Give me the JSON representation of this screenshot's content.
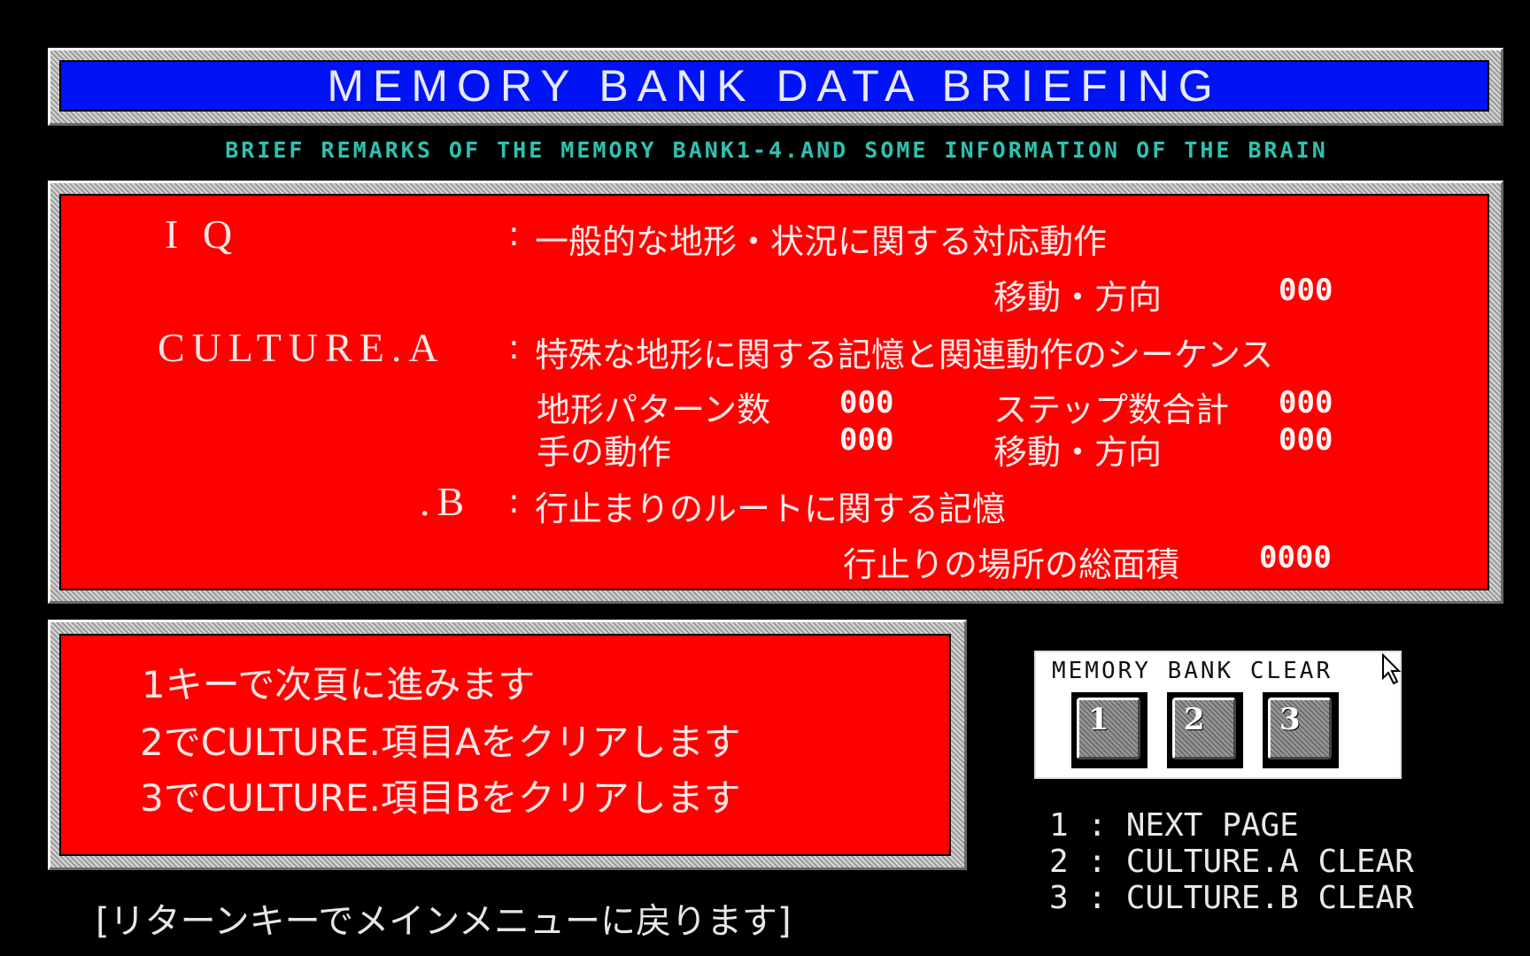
{
  "header": {
    "title": "MEMORY BANK DATA BRIEFING",
    "subtitle": "BRIEF REMARKS OF THE MEMORY BANK1-4.AND SOME INFORMATION OF THE BRAIN"
  },
  "colors": {
    "title_bar": "#0013f2",
    "panel": "#ff0000",
    "subtitle": "#2fc1b0",
    "background": "#000000"
  },
  "briefing": {
    "iq": {
      "label": "I Q",
      "colon": ":",
      "description": "一般的な地形・状況に関する対応動作",
      "stats": [
        {
          "label": "移動・方向",
          "value": "000"
        }
      ]
    },
    "culture_a": {
      "label": "CULTURE.A",
      "colon": ":",
      "description": "特殊な地形に関する記憶と関連動作のシーケンス",
      "stats": [
        {
          "label": "地形パターン数",
          "value": "000"
        },
        {
          "label": "ステップ数合計",
          "value": "000"
        },
        {
          "label": "手の動作",
          "value": "000"
        },
        {
          "label": "移動・方向",
          "value": "000"
        }
      ]
    },
    "culture_b": {
      "label": ".B",
      "colon": ":",
      "description": "行止まりのルートに関する記憶",
      "stats": [
        {
          "label": "行止りの場所の総面積",
          "value": "0000"
        }
      ]
    }
  },
  "instructions": [
    "1キーで次頁に進みます",
    "2でCULTURE.項目Aをクリアします",
    "3でCULTURE.項目Bをクリアします"
  ],
  "memory_bank_clear": {
    "title": "MEMORY BANK CLEAR",
    "keys": [
      "1",
      "2",
      "3"
    ]
  },
  "key_legend": [
    {
      "key": "1",
      "sep": ":",
      "action": "NEXT PAGE"
    },
    {
      "key": "2",
      "sep": ":",
      "action": "CULTURE.A CLEAR"
    },
    {
      "key": "3",
      "sep": ":",
      "action": "CULTURE.B CLEAR"
    }
  ],
  "footer": "[リターンキーでメインメニューに戻ります]"
}
